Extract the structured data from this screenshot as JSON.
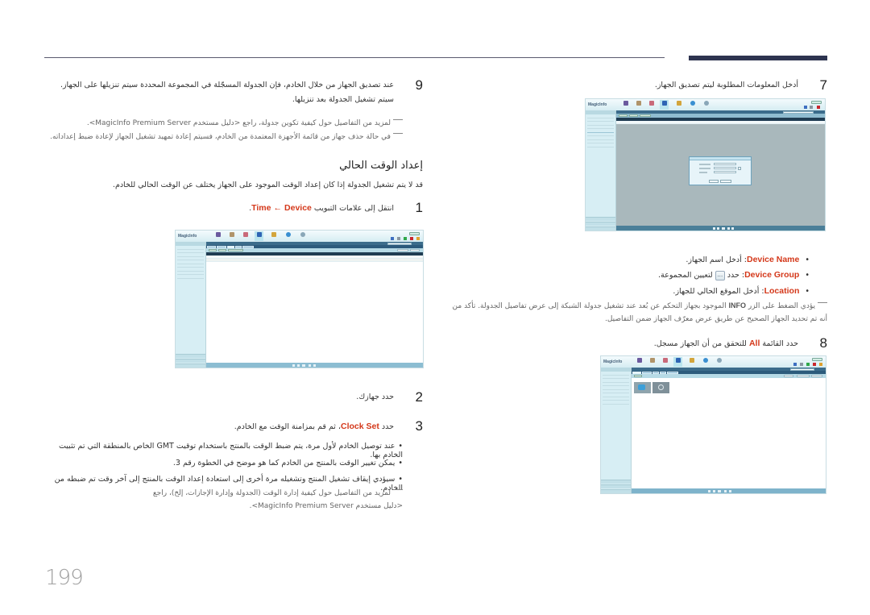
{
  "page": {
    "number": "199"
  },
  "left_column": {
    "step9": {
      "number": "9",
      "text": "عند تصديق الجهاز من خلال الخادم، فإن الجدولة المسجّلة في المجموعة المحددة سيتم تنزيلها على الجهاز. سيتم تشغيل الجدولة بعد تنزيلها."
    },
    "notes_step9": [
      "لمزيد من التفاصيل حول كيفية تكوين جدولة، راجع <دليل مستخدم MagicInfo Premium Server>.",
      "في حالة حذف جهاز من قائمة الأجهزة المعتمدة من الخادم، فسيتم إعادة تمهيد تشغيل الجهاز لإعادة ضبط إعداداته."
    ],
    "section_heading": "إعداد الوقت الحالي",
    "section_intro": "قد لا يتم تشغيل الجدولة إذا كان إعداد الوقت الموجود على الجهاز يختلف عن الوقت الحالي للخادم.",
    "step1": {
      "number": "1",
      "text_prefix": "انتقل إلى علامات التبويب",
      "highlight_a": "Time",
      "arrow": "←",
      "highlight_b": "Device",
      "suffix": "."
    },
    "step2": {
      "number": "2",
      "text": "حدد جهازك."
    },
    "step3": {
      "number": "3",
      "text_prefix": "حدد",
      "highlight": "Clock Set",
      "text_suffix": "، ثم قم بمزامنة الوقت مع الخادم."
    },
    "bullets_step3": [
      "عند توصيل الخادم لأول مرة، يتم ضبط الوقت بالمنتج باستخدام توقيت GMT الخاص بالمنطقة التي تم تثبيت الخادم بها.",
      "يمكن تغيير الوقت بالمنتج من الخادم كما هو موضح في الخطوة رقم 3.",
      "سيؤدي إيقاف تشغيل المنتج وتشغيله مرة أخرى إلى استعادة إعداد الوقت بالمنتج إلى آخر وقت تم ضبطه من الخادم."
    ],
    "note_step3": "لمزيد من التفاصيل حول كيفية إدارة الوقت (الجدولة وإدارة الإجازات، إلخ)، راجع <دليل مستخدم MagicInfo Premium Server>."
  },
  "right_column": {
    "step7": {
      "number": "7",
      "text": "أدخل المعلومات المطلوبة ليتم تصديق الجهاز."
    },
    "fields": [
      {
        "label": "Device Name",
        "text": ": أدخل اسم الجهاز."
      },
      {
        "label": "Device Group",
        "text_before_icon": ": حدد",
        "icon": "…",
        "text_after_icon": "لتعيين المجموعة."
      },
      {
        "label": "Location",
        "text": ": أدخل الموقع الحالي للجهاز."
      }
    ],
    "note_info": {
      "prefix": "يؤدي الضغط على الزر",
      "key": "INFO",
      "suffix": "الموجود بجهاز التحكم عن بُعد عند تشغيل جدولة الشبكة إلى عرض تفاصيل الجدولة. تأكد من أنه تم تحديد الجهاز الصحيح عن طريق عرض معرّف الجهاز ضمن التفاصيل."
    },
    "step8": {
      "number": "8",
      "text_prefix": "حدد القائمة",
      "highlight": "All",
      "text_suffix": "للتحقق من أن الجهاز مسجل."
    }
  },
  "screenshots": {
    "app_logo": "MagicInfo",
    "nav_icons": [
      "content-icon",
      "playlist-icon",
      "schedule-icon",
      "device-icon",
      "user-icon",
      "statistics-icon",
      "setting-icon"
    ],
    "dialog_title": "Approve Device",
    "dialog_ok": "OK",
    "dialog_cancel": "Cancel"
  },
  "colors": {
    "accent_red": "#d4381a",
    "header_bar": "#2e3450",
    "app_nav_bg": "#dff1f6",
    "app_table_head": "#1f3c52"
  }
}
